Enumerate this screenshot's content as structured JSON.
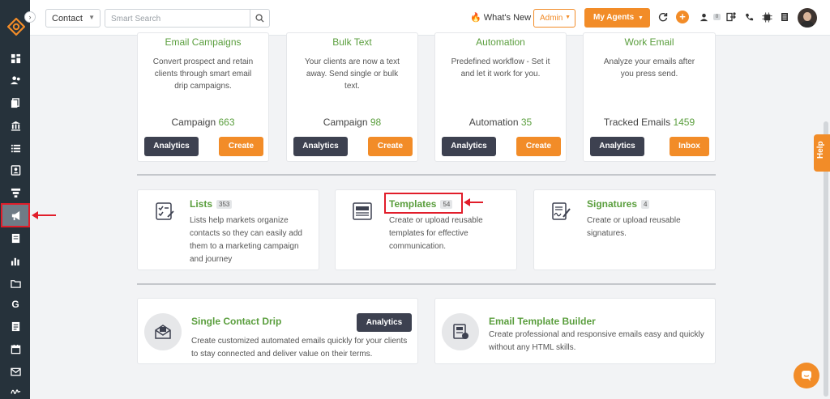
{
  "header": {
    "contact_select": "Contact",
    "search_placeholder": "Smart Search",
    "whats_new": "What's New",
    "admin": "Admin",
    "my_agents": "My Agents",
    "mini_badge": "0"
  },
  "top_cards": [
    {
      "title": "Email Campaigns",
      "desc": "Convert prospect and retain clients through smart email drip campaigns.",
      "stat_label": "Campaign",
      "stat_value": "663",
      "btn1": "Analytics",
      "btn2": "Create"
    },
    {
      "title": "Bulk Text",
      "desc": "Your clients are now a text away. Send single or bulk text.",
      "stat_label": "Campaign",
      "stat_value": "98",
      "btn1": "Analytics",
      "btn2": "Create"
    },
    {
      "title": "Automation",
      "desc": "Predefined workflow - Set it and let it work for you.",
      "stat_label": "Automation",
      "stat_value": "35",
      "btn1": "Analytics",
      "btn2": "Create"
    },
    {
      "title": "Work Email",
      "desc": "Analyze your emails after you press send.",
      "stat_label": "Tracked Emails",
      "stat_value": "1459",
      "btn1": "Analytics",
      "btn2": "Inbox"
    }
  ],
  "mid_cards": [
    {
      "title": "Lists",
      "count": "353",
      "desc": "Lists help markets organize contacts so they can easily add them to a marketing campaign and journey"
    },
    {
      "title": "Templates",
      "count": "54",
      "desc": "Create or upload reusable templates for effective communication."
    },
    {
      "title": "Signatures",
      "count": "4",
      "desc": "Create or upload reusable signatures."
    }
  ],
  "bottom_cards": [
    {
      "title": "Single Contact Drip",
      "desc": "Create customized automated emails quickly for your clients to stay connected and deliver value on their terms.",
      "btn": "Analytics"
    },
    {
      "title": "Email Template Builder",
      "desc": "Create professional and responsive emails easy and quickly without any HTML skills."
    }
  ],
  "help_label": "Help",
  "sidebar_g": "G",
  "icons": [
    "logo-icon",
    "dashboard-icon",
    "contacts-icon",
    "documents-icon",
    "bank-icon",
    "list-icon",
    "contact-card-icon",
    "funnel-icon",
    "megaphone-icon",
    "clipboard-icon",
    "chart-icon",
    "folder-icon",
    "google-icon",
    "calendar-list-icon",
    "calendar-icon",
    "mail-icon",
    "signature-icon"
  ],
  "colors": {
    "sidebar": "#26323b",
    "accent": "#f28c28",
    "green": "#5a9e3d",
    "dark_btn": "#3d4150",
    "annotation": "#e11d2a"
  }
}
